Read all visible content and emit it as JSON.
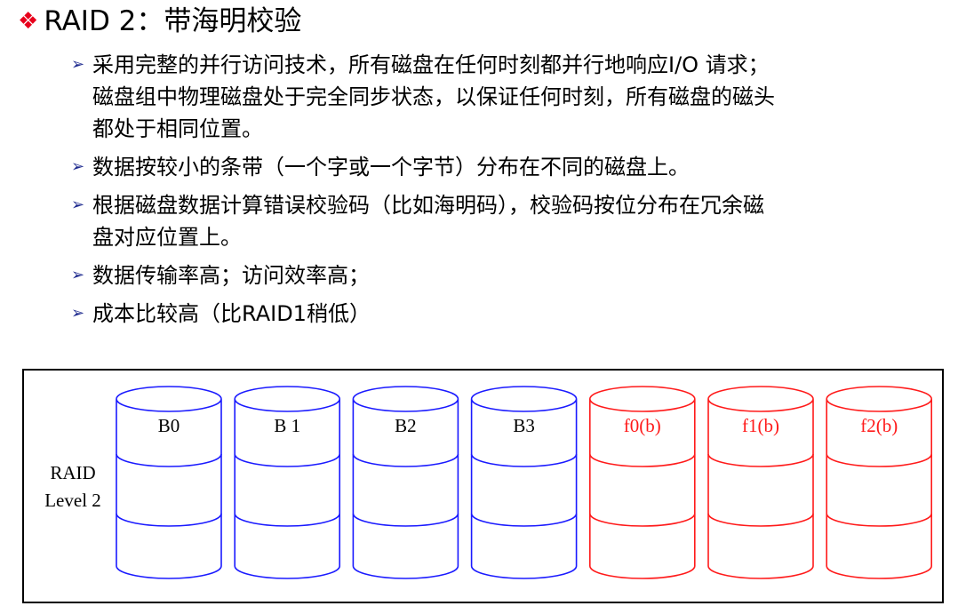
{
  "slide": {
    "title_bullet": "❖",
    "title": "RAID 2：带海明校验",
    "bullet_marker": "➢",
    "bullets": [
      {
        "lines": [
          "采用完整的并行访问技术，所有磁盘在任何时刻都并行地响应I/O 请求；",
          "磁盘组中物理磁盘处于完全同步状态，以保证任何时刻，所有磁盘的磁头",
          "都处于相同位置。"
        ]
      },
      {
        "lines": [
          "数据按较小的条带（一个字或一个字节）分布在不同的磁盘上。"
        ]
      },
      {
        "lines": [
          "根据磁盘数据计算错误校验码（比如海明码），校验码按位分布在冗余磁",
          "盘对应位置上。"
        ]
      },
      {
        "lines": [
          "数据传输率高；访问效率高；"
        ]
      },
      {
        "lines": [
          "成本比较高（比RAID1稍低）"
        ]
      }
    ]
  },
  "diagram": {
    "raid_label": [
      "RAID",
      "Level 2"
    ],
    "data_disk_color": "#1a1aff",
    "parity_disk_color": "#ff1a1a",
    "disks": [
      {
        "label": "B0",
        "kind": "data"
      },
      {
        "label": "B 1",
        "kind": "data"
      },
      {
        "label": "B2",
        "kind": "data"
      },
      {
        "label": "B3",
        "kind": "data"
      },
      {
        "label": "f0(b)",
        "kind": "parity"
      },
      {
        "label": "f1(b)",
        "kind": "parity"
      },
      {
        "label": "f2(b)",
        "kind": "parity"
      }
    ]
  }
}
